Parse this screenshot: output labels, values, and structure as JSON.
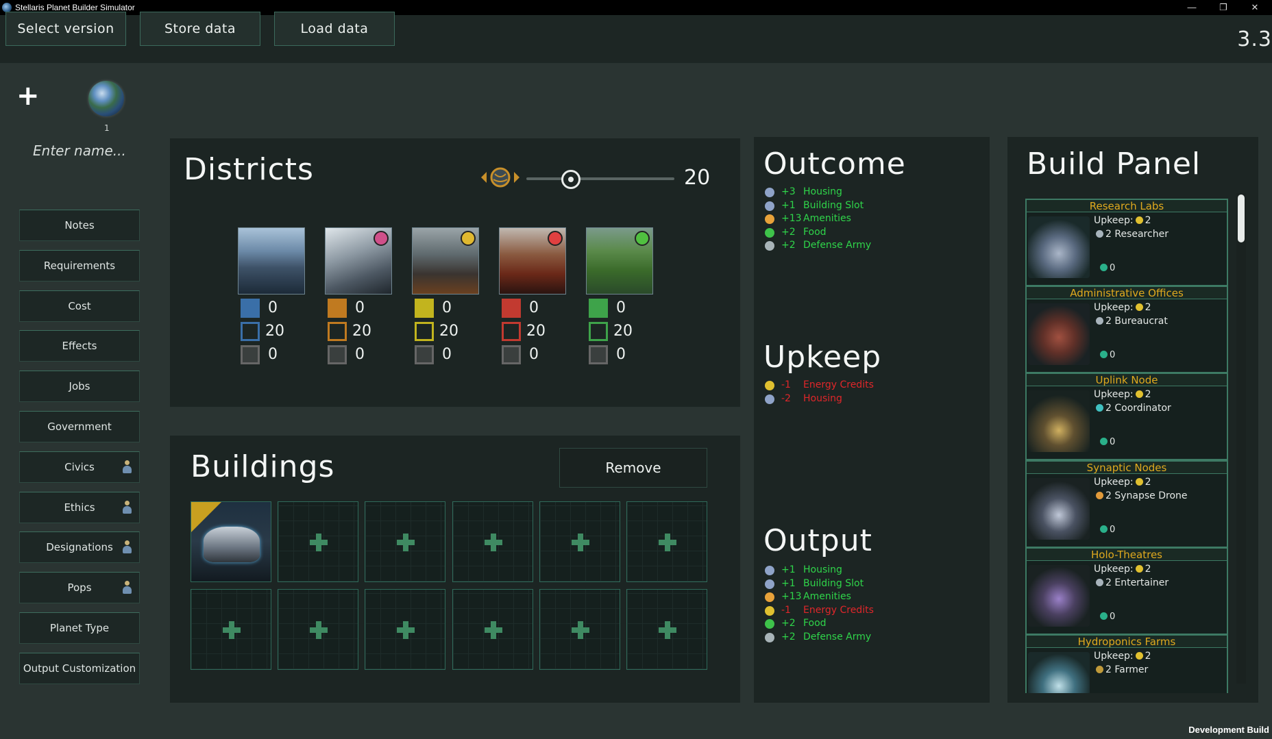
{
  "window": {
    "title": "Stellaris Planet Builder Simulator",
    "minimize": "—",
    "restore": "❐",
    "close": "✕"
  },
  "topbar": {
    "select_version": "Select version",
    "store_data": "Store data",
    "load_data": "Load data",
    "version": "3.3"
  },
  "planet_selector": {
    "add": "+",
    "count": "1",
    "name_placeholder": "Enter name..."
  },
  "sidebar": {
    "items": [
      {
        "label": "Notes"
      },
      {
        "label": "Requirements"
      },
      {
        "label": "Cost"
      },
      {
        "label": "Effects"
      },
      {
        "label": "Jobs"
      },
      {
        "label": "Government"
      },
      {
        "label": "Civics"
      },
      {
        "label": "Ethics"
      },
      {
        "label": "Designations"
      },
      {
        "label": "Pops"
      },
      {
        "label": "Planet Type"
      },
      {
        "label": "Output Customization"
      }
    ]
  },
  "districts": {
    "title": "Districts",
    "planet_size": "20",
    "planet_size_fraction": 0.3,
    "columns": [
      {
        "name": "city",
        "color": "#3a6fa8",
        "built": "0",
        "max": "20",
        "extra": "0"
      },
      {
        "name": "industrial",
        "color": "#c07a20",
        "built": "0",
        "max": "20",
        "extra": "0"
      },
      {
        "name": "generator",
        "color": "#c2b41e",
        "built": "0",
        "max": "20",
        "extra": "0"
      },
      {
        "name": "mining",
        "color": "#c23a30",
        "built": "0",
        "max": "20",
        "extra": "0"
      },
      {
        "name": "agriculture",
        "color": "#3ea34a",
        "built": "0",
        "max": "20",
        "extra": "0"
      }
    ]
  },
  "buildings": {
    "title": "Buildings",
    "remove_label": "Remove",
    "slots": 12
  },
  "outcome": {
    "title": "Outcome",
    "lines": [
      {
        "num": "+3",
        "label": "Housing",
        "tone": "green",
        "icon": "#8fa3c8"
      },
      {
        "num": "+1",
        "label": "Building Slot",
        "tone": "green",
        "icon": "#8fa3c8"
      },
      {
        "num": "+13",
        "label": "Amenities",
        "tone": "green",
        "icon": "#e8a23a"
      },
      {
        "num": "+2",
        "label": "Food",
        "tone": "green",
        "icon": "#3ec24a"
      },
      {
        "num": "+2",
        "label": "Defense Army",
        "tone": "green",
        "icon": "#a8b4b8"
      }
    ]
  },
  "upkeep": {
    "title": "Upkeep",
    "lines": [
      {
        "num": "-1",
        "label": "Energy Credits",
        "tone": "red",
        "icon": "#e0c030"
      },
      {
        "num": "-2",
        "label": "Housing",
        "tone": "red",
        "icon": "#8fa3c8"
      }
    ]
  },
  "output": {
    "title": "Output",
    "lines": [
      {
        "num": "+1",
        "label": "Housing",
        "tone": "green",
        "icon": "#8fa3c8"
      },
      {
        "num": "+1",
        "label": "Building Slot",
        "tone": "green",
        "icon": "#8fa3c8"
      },
      {
        "num": "+13",
        "label": "Amenities",
        "tone": "green",
        "icon": "#e8a23a"
      },
      {
        "num": "-1",
        "label": "Energy Credits",
        "tone": "red",
        "icon": "#e0c030"
      },
      {
        "num": "+2",
        "label": "Food",
        "tone": "green",
        "icon": "#3ec24a"
      },
      {
        "num": "+2",
        "label": "Defense Army",
        "tone": "green",
        "icon": "#a8b4b8"
      }
    ]
  },
  "build_panel": {
    "title": "Build Panel",
    "cards": [
      {
        "name": "Research Labs",
        "upkeep": "Upkeep:",
        "upkeep_val": "2",
        "job": "2 Researcher",
        "slots": "0"
      },
      {
        "name": "Administrative Offices",
        "upkeep": "Upkeep:",
        "upkeep_val": "2",
        "job": "2 Bureaucrat",
        "slots": "0"
      },
      {
        "name": "Uplink Node",
        "upkeep": "Upkeep:",
        "upkeep_val": "2",
        "job": "2 Coordinator",
        "slots": "0"
      },
      {
        "name": "Synaptic Nodes",
        "upkeep": "Upkeep:",
        "upkeep_val": "2",
        "job": "2 Synapse Drone",
        "slots": "0"
      },
      {
        "name": "Holo-Theatres",
        "upkeep": "Upkeep:",
        "upkeep_val": "2",
        "job": "2 Entertainer",
        "slots": "0"
      },
      {
        "name": "Hydroponics Farms",
        "upkeep": "Upkeep:",
        "upkeep_val": "2",
        "job": "2 Farmer",
        "slots": ""
      }
    ]
  },
  "footer": {
    "dev_build": "Development Build"
  }
}
